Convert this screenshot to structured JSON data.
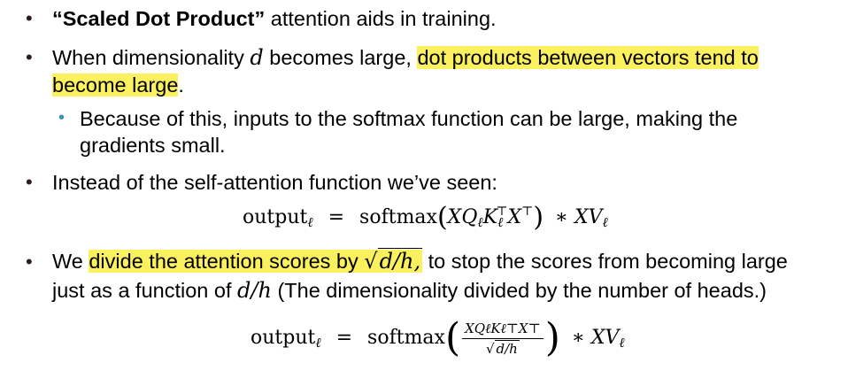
{
  "bullets": [
    {
      "bold_prefix": "“Scaled Dot Product”",
      "rest": " attention aids in training."
    },
    {
      "text_a": "When dimensionality ",
      "math_d": "d",
      "text_b": " becomes large, ",
      "highlight_a": "dot products between vectors tend to",
      "highlight_b": "become large",
      "text_c": "."
    },
    {
      "line1": "Because of this, inputs to the softmax function can be large, making the",
      "line2": "gradients small."
    },
    {
      "text": "Instead of the self-attention function we’ve seen:"
    },
    {
      "text_a": "We ",
      "highlight": "divide the attention scores by ",
      "sqrt_content": "d/h,",
      "text_b": " to stop the scores from becoming large",
      "line2_a": "just as a function of ",
      "line2_math": "d/h",
      "line2_b": " (The dimensionality divided by the number of heads.)"
    }
  ],
  "formula1": {
    "lhs": "output",
    "sub": "ℓ",
    "eq": "=",
    "fn": "softmax",
    "body": "XQ",
    "body_sub1": "ℓ",
    "k": "K",
    "k_sub": "ℓ",
    "t1": "⊤",
    "x": "X",
    "t2": "⊤",
    "rest": "∗ XV",
    "rest_sub": "ℓ"
  },
  "formula2": {
    "lhs": "output",
    "sub": "ℓ",
    "eq": "=",
    "fn": "softmax",
    "num": "XQℓKℓ⊤X⊤",
    "den": "d/h",
    "sqrt": "√",
    "rest": "∗ XV",
    "rest_sub": "ℓ"
  },
  "colors": {
    "highlight": "#fbf15e",
    "bullet": "#2b1b1b",
    "sub_bullet": "#3e8fbd"
  }
}
